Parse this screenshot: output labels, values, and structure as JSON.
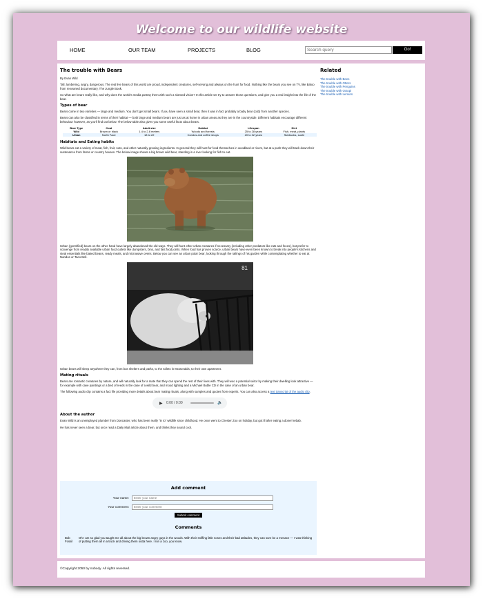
{
  "header": {
    "title": "Welcome to our wildlife website"
  },
  "nav": {
    "items": [
      "HOME",
      "OUR TEAM",
      "PROJECTS",
      "BLOG"
    ],
    "search_placeholder": "Search query",
    "search_button": "Go!"
  },
  "article": {
    "title": "The trouble with Bears",
    "byline": "By Evan Wild",
    "intro1": "Tall, lumbering, angry, dangerous. The real live bears of this world are proud, independent creatures, self-serving and always on the hunt for food. Nothing like the bears you see on TV, like Baloo from renowned documentary, The Jungle Book.",
    "intro2": "So what are bears really like, and why does the world's media portray them with such a skewed vision? In this article we try to answer those questions, and give you a real insight into the life of the bear.",
    "types_heading": "Types of bear",
    "types_p1": "Bears come in two varieties — large and medium. You don't get small bears. If you have seen a small bear, then it was in fact probably a baby bear (cub) from another species.",
    "types_p2": "Bears can also be classified in terms of their habitat — both large and medium bears are just as at home in urban areas as they are in the countryside. Different habitats encourage different behaviour however, as you'll find out below. The below table also gives you some useful facts about bears.",
    "table": {
      "headers": [
        "Bear Type",
        "Coat",
        "Adult size",
        "Habitat",
        "Lifespan",
        "Diet"
      ],
      "rows": [
        [
          "Wild",
          "Brown or black",
          "1.4 to 2.8 meters",
          "Woods and forests",
          "25 to 28 years",
          "Fish, meat, plants"
        ],
        [
          "Urban",
          "North Face",
          "18 to 22",
          "Condos and coffee shops",
          "20 to 32 years",
          "Starbucks, sushi"
        ]
      ]
    },
    "habitats_heading": "Habitats and Eating habits",
    "habitats_p1": "Wild bears eat a variety of meat, fish, fruit, nuts, and other naturally growing ingredients. In general they will hunt for food themselves in woodland or rivers, but at a push they will track down their sustenance from farms or country houses. The below image shows a big brown wild bear, standing in a river looking for fish to eat.",
    "habitats_p2": "Urban (gentrified) bears on the other hand have largely abandoned the old ways. They will hunt other urban creatures if necessary (including other predators like rats and foxes), but prefer to scavenge from readily available urban food outlets like dumpsters, bins, and fast food joints. When food has proven scarce, urban bears have even been known to break into people's kitchens and steal essentials like baked beans, ready meals, and microwave ovens. Below you can see an urban polar bear, looking through the railings of his garden while contemplating whether to eat at Nandos or Taco Bell.",
    "photo2_overlay": "81",
    "urban_sleep": "Urban bears will sleep anywhere they can, from bus shelters and parks, to the toilets in McDonalds, to their own apartment.",
    "mating_heading": "Mating rituals",
    "mating_p1": "Bears are romantic creatures by nature, and will naturally look for a mate that they can spend the rest of their lives with. They will woo a potential suitor by making their dwelling look attractive — for example with cave paintings or a bed of reeds in the case of a wild bear, and mood lighting and a Michael Buble CD in the case of an urban bear.",
    "mating_p2_text": "The following audio clip contains a fact file providing more details about bear mating rituals, along with samples and quotes from experts. You can also access a ",
    "mating_p2_link": "text transcript of the audio clip",
    "mating_p2_end": ".",
    "audio_time": "0:00 / 0:00",
    "about_heading": "About the author",
    "about_p1": "Evan Wild is an unemployed plumber from Doncaster, who has been really \"in to\" wildlife since childhood. He once went to Chester Zoo on holiday, but got ill after eating a doner kebab.",
    "about_p2": "He has never seen a bear, but once read a Daily Mail article about them, and thinks they sound cool."
  },
  "sidebar": {
    "title": "Related",
    "links": [
      "The trouble with Bees",
      "The trouble with Otters",
      "The trouble with Penguins",
      "The trouble with Octopi",
      "The trouble with Lemurs"
    ]
  },
  "comments": {
    "add_title": "Add comment",
    "name_label": "Your name:",
    "name_placeholder": "Enter your name",
    "comment_label": "Your comment:",
    "comment_placeholder": "Enter your comment",
    "submit_label": "Submit comment",
    "list_title": "Comments",
    "items": [
      {
        "author": "Bob Fossil",
        "text": "Oh I am so glad you taught me all about the big brown angry guys in the woods. With their sniffing little noses and their bad attitudes, they can sure be a menace — I was thinking of putting them all in a truck and driving them outta here. I run a zoo, you know."
      }
    ]
  },
  "footer": {
    "copyright": "©Copyright 2050 by nobody. All rights reversed."
  }
}
